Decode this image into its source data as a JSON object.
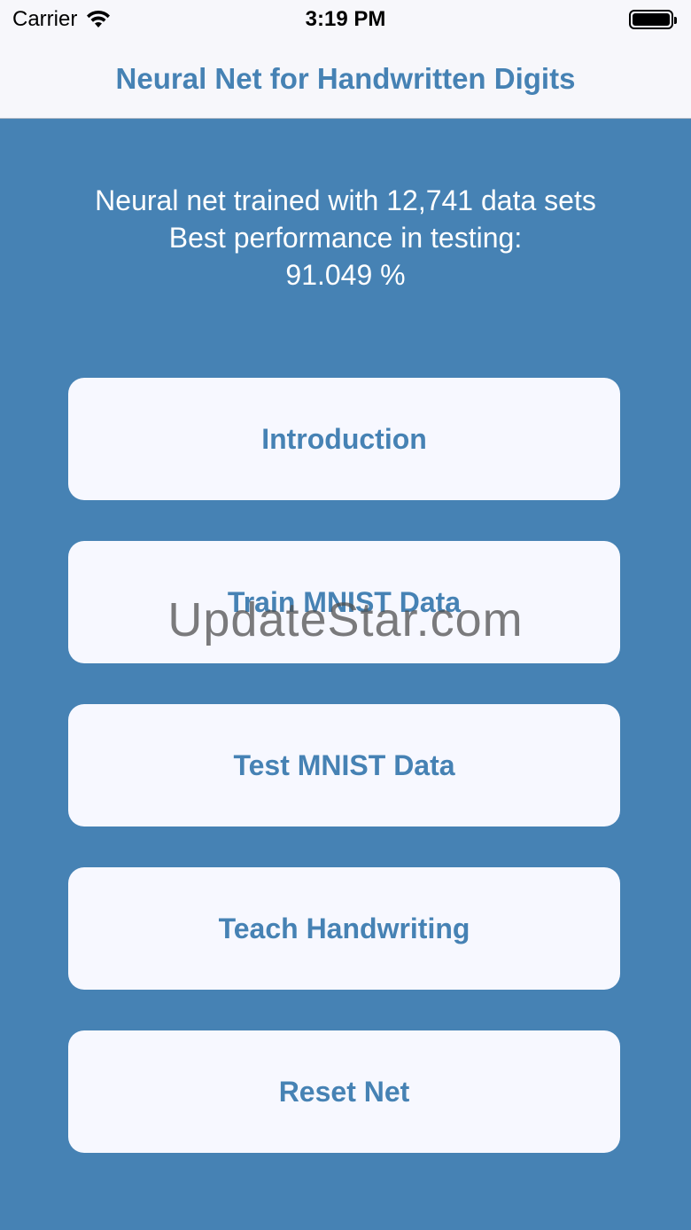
{
  "status_bar": {
    "carrier": "Carrier",
    "time": "3:19 PM",
    "wifi_icon": "wifi-icon",
    "battery_icon": "battery-icon"
  },
  "nav": {
    "title": "Neural Net for Handwritten Digits"
  },
  "info": {
    "line1": "Neural net trained with 12,741 data sets",
    "line2": "Best performance in testing:",
    "line3": "91.049 %"
  },
  "buttons": [
    {
      "label": "Introduction"
    },
    {
      "label": "Train MNIST Data"
    },
    {
      "label": "Test MNIST Data"
    },
    {
      "label": "Teach Handwriting"
    },
    {
      "label": "Reset Net"
    }
  ],
  "watermark": "UpdateStar.com",
  "colors": {
    "accent": "#4682b4",
    "background": "#4682b4",
    "button_bg": "#f7f8ff",
    "nav_bg": "#f7f7fb"
  }
}
